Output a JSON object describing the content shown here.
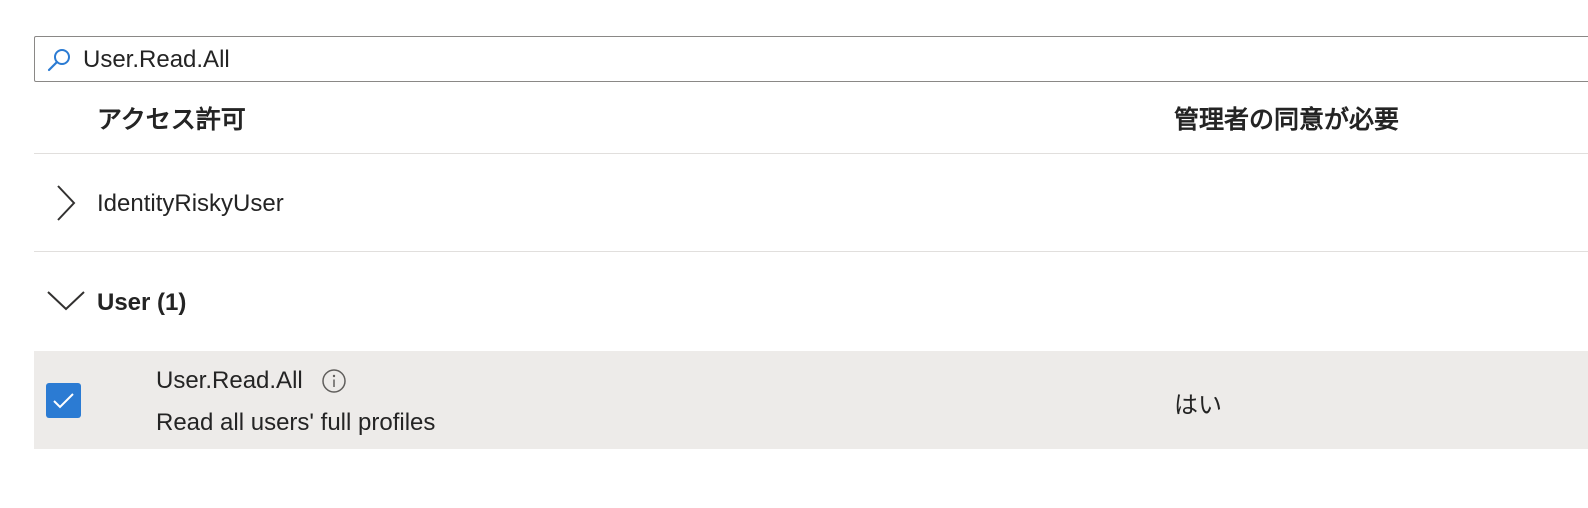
{
  "search": {
    "value": "User.Read.All",
    "icon": "search-icon"
  },
  "columns": {
    "permission": "アクセス許可",
    "admin_consent": "管理者の同意が必要"
  },
  "groups": [
    {
      "label": "IdentityRiskyUser",
      "expanded": false,
      "icon": "chevron-right-icon"
    },
    {
      "label": "User (1)",
      "expanded": true,
      "icon": "chevron-down-icon",
      "permissions": [
        {
          "name": "User.Read.All",
          "description": "Read all users' full profiles",
          "admin_consent": "はい",
          "checked": true
        }
      ]
    }
  ],
  "colors": {
    "accent": "#2b7bd3",
    "selected_row": "#edebe9",
    "divider": "#e1dfdd"
  }
}
